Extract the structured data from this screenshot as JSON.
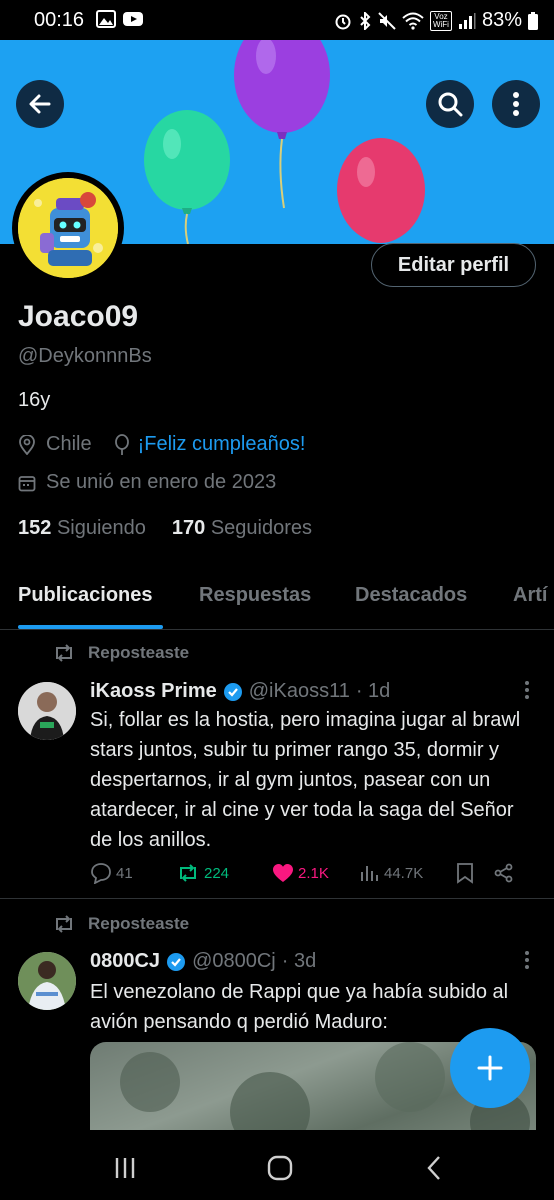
{
  "status": {
    "time": "00:16",
    "battery": "83%",
    "network_label": "Voz WiFi"
  },
  "profile": {
    "edit_button": "Editar perfil",
    "display_name": "Joaco09",
    "handle": "@DeykonnnBs",
    "bio": "16y",
    "location": "Chile",
    "birthday": "¡Feliz cumpleaños!",
    "joined": "Se unió en enero de 2023",
    "following_count": "152",
    "following_label": "Siguiendo",
    "followers_count": "170",
    "followers_label": "Seguidores"
  },
  "tabs": [
    "Publicaciones",
    "Respuestas",
    "Destacados",
    "Artí"
  ],
  "posts": [
    {
      "repost_label": "Reposteaste",
      "name": "iKaoss Prime",
      "handle": "@iKaoss11",
      "time": "· 1d",
      "text": "Si, follar es la hostia, pero imagina jugar al brawl stars juntos, subir tu primer rango 35, dormir y despertarnos, ir al gym juntos, pasear con un atardecer, ir al cine y ver toda la saga del Señor de los anillos.",
      "replies": "41",
      "reposts": "224",
      "likes": "2.1K",
      "views": "44.7K"
    },
    {
      "repost_label": "Reposteaste",
      "name": "0800CJ",
      "handle": "@0800Cj",
      "time": "· 3d",
      "text": "El venezolano de Rappi que ya había subido al avión pensando q perdió Maduro:"
    }
  ],
  "colors": {
    "banner": "#1da1f2",
    "accent": "#1d9bf0",
    "repost_green": "#00ba7c",
    "like_pink": "#f91880"
  }
}
